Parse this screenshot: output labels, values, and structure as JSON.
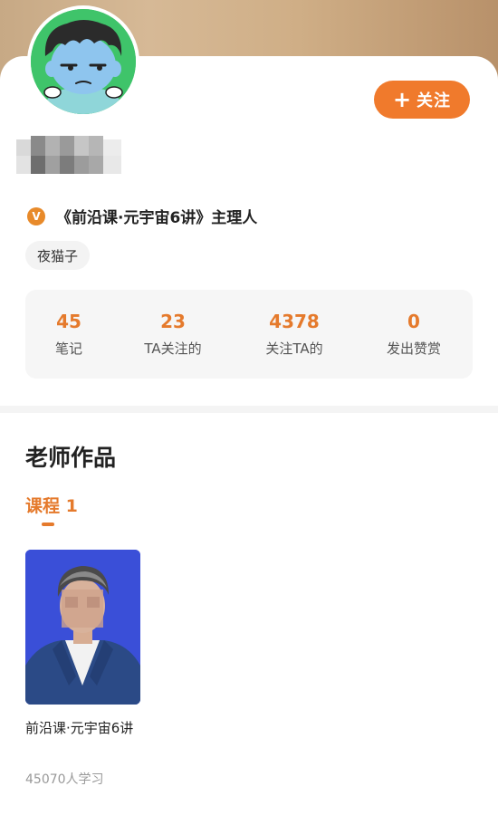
{
  "profile": {
    "follow_plus": "+",
    "follow_label": "关注",
    "verified_badge": "V",
    "role_title": "《前沿课·元宇宙6讲》主理人",
    "tag": "夜猫子"
  },
  "stats": [
    {
      "value": "45",
      "label": "笔记"
    },
    {
      "value": "23",
      "label": "TA关注的"
    },
    {
      "value": "4378",
      "label": "关注TA的"
    },
    {
      "value": "0",
      "label": "发出赞赏"
    }
  ],
  "works": {
    "section_title": "老师作品",
    "tab_label": "课程 1",
    "courses": [
      {
        "title": "前沿课·元宇宙6讲",
        "learners": "45070人学习"
      }
    ]
  },
  "colors": {
    "accent": "#f07a2c",
    "accent_text": "#e57a2c",
    "thumb_bg": "#3a4fd8",
    "avatar_bg": "#3fc46a"
  }
}
